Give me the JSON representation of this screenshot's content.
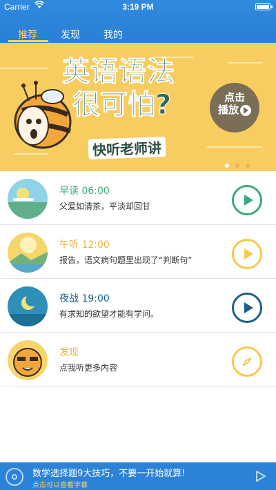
{
  "status_bar": {
    "carrier": "Carrier",
    "wifi_icon": "wifi-icon",
    "time": "3:19 PM",
    "battery_icon": "battery-icon"
  },
  "tabs": [
    {
      "label": "推荐",
      "active": true
    },
    {
      "label": "发现",
      "active": false
    },
    {
      "label": "我的",
      "active": false
    }
  ],
  "banner": {
    "headline_line1": "英语语法",
    "headline_line2": "很可怕?",
    "subhead": "快听老师讲",
    "badge_line1": "点击",
    "badge_line2": "播放",
    "page_count": 3,
    "current_page": 1
  },
  "items": [
    {
      "title": "早读 06:00",
      "desc": "父爱如清茶，平淡却回甘",
      "color": "#3aa97b",
      "icon": "play-icon"
    },
    {
      "title": "午听 12:00",
      "desc": "报告，语文病句题里出现了“判断句”",
      "color": "#f5c94c",
      "icon": "play-icon"
    },
    {
      "title": "夜战 19:00",
      "desc": "有求知的欲望才能有学问。",
      "color": "#1c5e8c",
      "icon": "play-icon"
    },
    {
      "title": "发现",
      "desc": "点我听更多内容",
      "color": "#f5c94c",
      "icon": "compass-icon"
    }
  ],
  "player": {
    "title": "数学选择题9大技巧，不要一开始就算!",
    "subtitle": "点击可以查看字幕",
    "accent": "#f6d46a"
  }
}
